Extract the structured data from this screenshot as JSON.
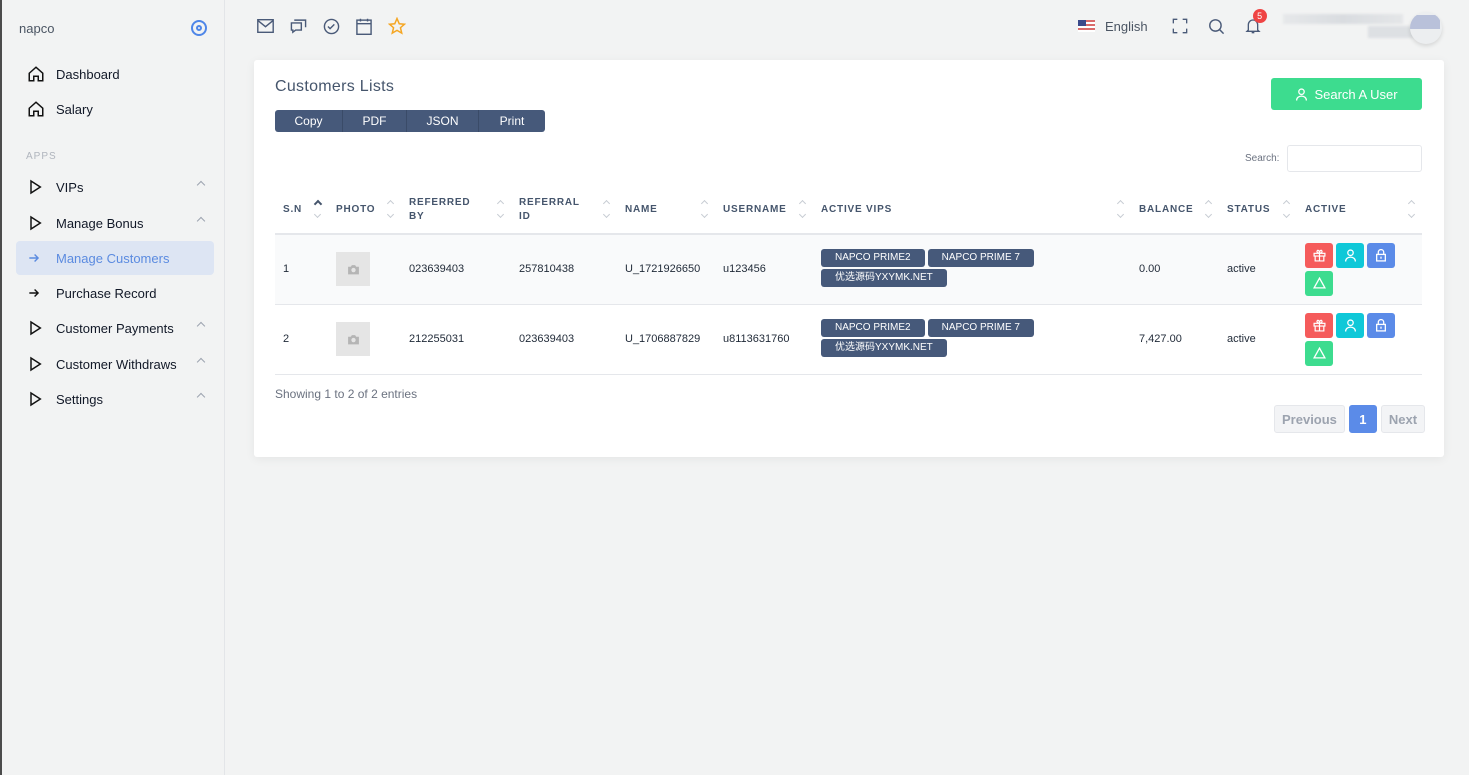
{
  "sidebar": {
    "brand": "napco",
    "section_label": "APPS",
    "items": [
      {
        "label": "Dashboard",
        "icon": "home-icon"
      },
      {
        "label": "Salary",
        "icon": "home-icon"
      },
      {
        "label": "VIPs",
        "icon": "play-icon",
        "expandable": true
      },
      {
        "label": "Manage Bonus",
        "icon": "play-icon",
        "expandable": true
      },
      {
        "label": "Manage Customers",
        "icon": "arrow-right-icon",
        "active": true
      },
      {
        "label": "Purchase Record",
        "icon": "arrow-right-icon"
      },
      {
        "label": "Customer Payments",
        "icon": "play-icon",
        "expandable": true
      },
      {
        "label": "Customer Withdraws",
        "icon": "play-icon",
        "expandable": true
      },
      {
        "label": "Settings",
        "icon": "play-icon",
        "expandable": true
      }
    ]
  },
  "topbar": {
    "icons": [
      "mail-icon",
      "chat-icon",
      "check-circle-icon",
      "calendar-icon",
      "star-icon"
    ],
    "language": "English",
    "notification_count": "5"
  },
  "card": {
    "title": "Customers Lists",
    "export_buttons": [
      "Copy",
      "PDF",
      "JSON",
      "Print"
    ],
    "search_user_label": "Search A User",
    "search_label": "Search:",
    "search_value": "",
    "columns": [
      "S.N",
      "PHOTO",
      "REFERRED BY",
      "REFERRAL ID",
      "NAME",
      "USERNAME",
      "ACTIVE VIPS",
      "BALANCE",
      "STATUS",
      "ACTIVE"
    ],
    "rows": [
      {
        "sn": "1",
        "referred_by": "023639403",
        "referral_id": "257810438",
        "name": "U_1721926650",
        "username": "u123456",
        "vips": [
          "NAPCO PRIME2",
          "NAPCO PRIME 7",
          "优选源码YXYMK.NET"
        ],
        "balance": "0.00",
        "status": "active"
      },
      {
        "sn": "2",
        "referred_by": "212255031",
        "referral_id": "023639403",
        "name": "U_1706887829",
        "username": "u8113631760",
        "vips": [
          "NAPCO PRIME2",
          "NAPCO PRIME 7",
          "优选源码YXYMK.NET"
        ],
        "balance": "7,427.00",
        "status": "active"
      }
    ],
    "info": "Showing 1 to 2 of 2 entries",
    "pagination": {
      "previous": "Previous",
      "current": "1",
      "next": "Next"
    }
  },
  "colors": {
    "accent": "#5b8be8",
    "success": "#3ddc8f",
    "danger": "#f55b5b",
    "info": "#0fc8d8",
    "dark": "#46597a"
  }
}
